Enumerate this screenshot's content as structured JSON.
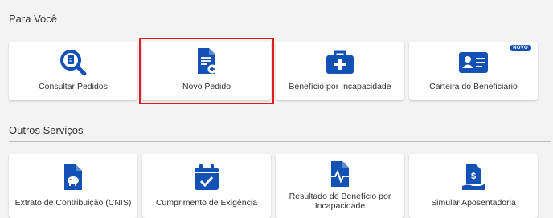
{
  "colors": {
    "accent": "#1351b4",
    "highlight": "#e01b1b"
  },
  "sections": {
    "para_voce": "Para Você",
    "outros_servicos": "Outros Serviços"
  },
  "para_voce_cards": [
    {
      "label": "Consultar Pedidos",
      "icon": "search-document-icon"
    },
    {
      "label": "Novo Pedido",
      "icon": "new-document-icon"
    },
    {
      "label": "Benefício por Incapacidade",
      "icon": "medical-kit-icon"
    },
    {
      "label": "Carteira do Beneficiário",
      "icon": "id-card-icon",
      "badge": "NOVO"
    }
  ],
  "outros_cards": [
    {
      "label": "Extrato de Contribuição (CNIS)",
      "icon": "piggy-bank-document-icon"
    },
    {
      "label": "Cumprimento de Exigência",
      "icon": "calendar-check-icon"
    },
    {
      "label": "Resultado de Benefício por Incapacidade",
      "icon": "pulse-document-icon"
    },
    {
      "label": "Simular Aposentadoria",
      "icon": "money-hand-icon"
    }
  ]
}
